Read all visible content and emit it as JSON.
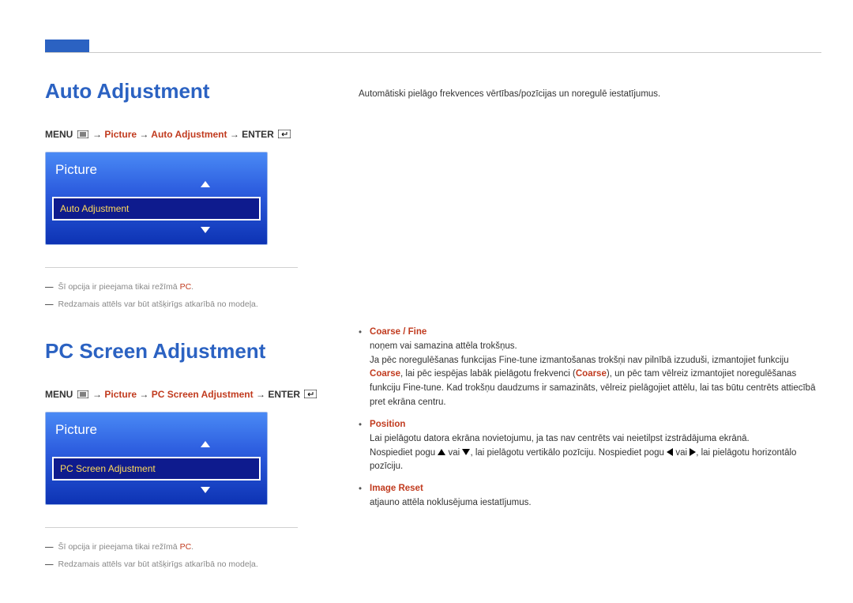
{
  "section1": {
    "title": "Auto Adjustment",
    "menuPath": {
      "menu": "MENU",
      "crumbs": [
        "Picture",
        "Auto Adjustment"
      ],
      "enter": "ENTER"
    },
    "tv": {
      "title": "Picture",
      "selected": "Auto Adjustment"
    },
    "notes": [
      {
        "prefix": "Šī opcija ir pieejama tikai režīmā ",
        "accent": "PC",
        "suffix": "."
      },
      {
        "prefix": "Redzamais attēls var būt atšķirīgs atkarībā no modeļa.",
        "accent": "",
        "suffix": ""
      }
    ],
    "rightIntro": "Automātiski pielāgo frekvences vērtības/pozīcijas un noregulē iestatījumus."
  },
  "section2": {
    "title": "PC Screen Adjustment",
    "menuPath": {
      "menu": "MENU",
      "crumbs": [
        "Picture",
        "PC Screen Adjustment"
      ],
      "enter": "ENTER"
    },
    "tv": {
      "title": "Picture",
      "selected": "PC Screen Adjustment"
    },
    "notes": [
      {
        "prefix": "Šī opcija ir pieejama tikai režīmā ",
        "accent": "PC",
        "suffix": "."
      },
      {
        "prefix": "Redzamais attēls var būt atšķirīgs atkarībā no modeļa.",
        "accent": "",
        "suffix": ""
      }
    ],
    "bullets": {
      "coarseFine": {
        "title": "Coarse / Fine",
        "line1": "noņem vai samazina attēla trokšņus.",
        "line2_a": "Ja pēc noregulēšanas funkcijas Fine-tune izmantošanas trokšņi nav pilnībā izzuduši, izmantojiet funkciju ",
        "line2_accent1": "Coarse",
        "line2_b": ", lai pēc iespējas labāk pielāgotu frekvenci (",
        "line2_accent2": "Coarse",
        "line2_c": "), un pēc tam vēlreiz izmantojiet noregulēšanas funkciju Fine-tune. Kad trokšņu daudzums ir samazināts, vēlreiz pielāgojiet attēlu, lai tas būtu centrēts attiecībā pret ekrāna centru."
      },
      "position": {
        "title": "Position",
        "line1": "Lai pielāgotu datora ekrāna novietojumu, ja tas nav centrēts vai neietilpst izstrādājuma ekrānā.",
        "line2_a": "Nospiediet pogu ",
        "line2_b": " vai ",
        "line2_c": ", lai pielāgotu vertikālo pozīciju. Nospiediet pogu ",
        "line2_d": " vai ",
        "line2_e": ", lai pielāgotu horizontālo pozīciju."
      },
      "imageReset": {
        "title": "Image Reset",
        "line1": "atjauno attēla noklusējuma iestatījumus."
      }
    }
  }
}
